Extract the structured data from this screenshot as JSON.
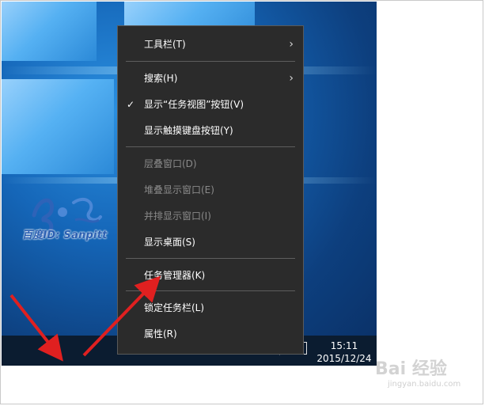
{
  "menu": {
    "items": [
      {
        "label": "工具栏(T)",
        "submenu": true,
        "checked": false,
        "disabled": false
      },
      {
        "label": "搜索(H)",
        "submenu": true,
        "checked": false,
        "disabled": false
      },
      {
        "label": "显示“任务视图”按钮(V)",
        "submenu": false,
        "checked": true,
        "disabled": false
      },
      {
        "label": "显示触摸键盘按钮(Y)",
        "submenu": false,
        "checked": false,
        "disabled": false
      },
      {
        "label": "层叠窗口(D)",
        "submenu": false,
        "checked": false,
        "disabled": true
      },
      {
        "label": "堆叠显示窗口(E)",
        "submenu": false,
        "checked": false,
        "disabled": true
      },
      {
        "label": "并排显示窗口(I)",
        "submenu": false,
        "checked": false,
        "disabled": true
      },
      {
        "label": "显示桌面(S)",
        "submenu": false,
        "checked": false,
        "disabled": false
      },
      {
        "label": "任务管理器(K)",
        "submenu": false,
        "checked": false,
        "disabled": false
      },
      {
        "label": "锁定任务栏(L)",
        "submenu": false,
        "checked": true,
        "disabled": false
      },
      {
        "label": "属性(R)",
        "submenu": false,
        "checked": false,
        "disabled": false
      }
    ],
    "chevron": "›",
    "checkmark": "✓"
  },
  "taskbar": {
    "clock_time": "15:11",
    "clock_date": "2015/12/24"
  },
  "watermark": {
    "logo_caption": "百度ID: Sanpitt",
    "brand": "Bai 经验",
    "url": "jingyan.baidu.com"
  },
  "colors": {
    "menu_bg": "#2b2b2b",
    "annotation_arrow": "#e02020"
  }
}
